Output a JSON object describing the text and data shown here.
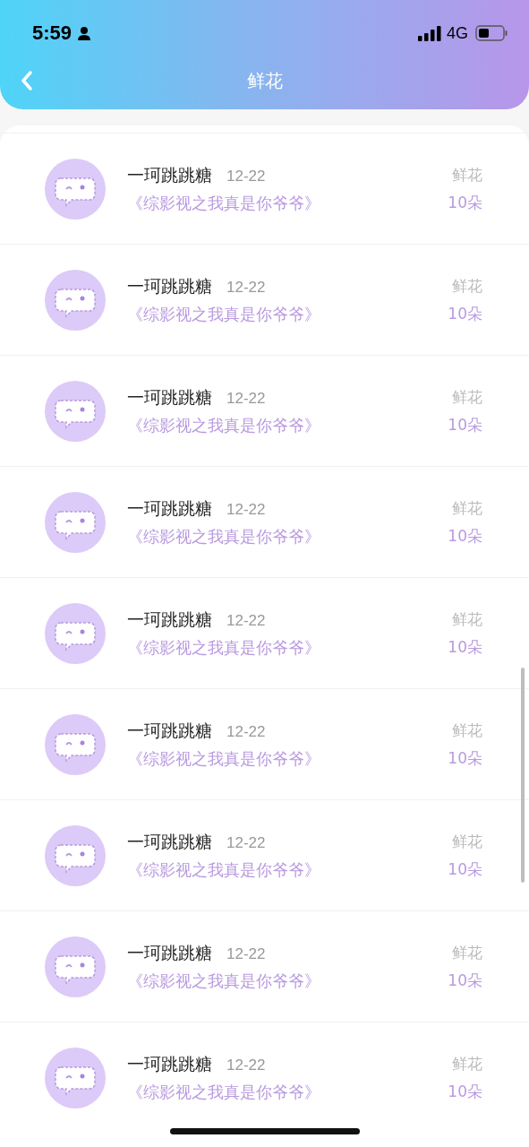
{
  "status_bar": {
    "time": "5:59",
    "network": "4G"
  },
  "header": {
    "title": "鲜花"
  },
  "rows": [
    {
      "name": "一珂跳跳糖",
      "date": "12-22",
      "book": "《综影视之我真是你爷爷》",
      "label": "鲜花",
      "amount": "10朵"
    },
    {
      "name": "一珂跳跳糖",
      "date": "12-22",
      "book": "《综影视之我真是你爷爷》",
      "label": "鲜花",
      "amount": "10朵"
    },
    {
      "name": "一珂跳跳糖",
      "date": "12-22",
      "book": "《综影视之我真是你爷爷》",
      "label": "鲜花",
      "amount": "10朵"
    },
    {
      "name": "一珂跳跳糖",
      "date": "12-22",
      "book": "《综影视之我真是你爷爷》",
      "label": "鲜花",
      "amount": "10朵"
    },
    {
      "name": "一珂跳跳糖",
      "date": "12-22",
      "book": "《综影视之我真是你爷爷》",
      "label": "鲜花",
      "amount": "10朵"
    },
    {
      "name": "一珂跳跳糖",
      "date": "12-22",
      "book": "《综影视之我真是你爷爷》",
      "label": "鲜花",
      "amount": "10朵"
    },
    {
      "name": "一珂跳跳糖",
      "date": "12-22",
      "book": "《综影视之我真是你爷爷》",
      "label": "鲜花",
      "amount": "10朵"
    },
    {
      "name": "一珂跳跳糖",
      "date": "12-22",
      "book": "《综影视之我真是你爷爷》",
      "label": "鲜花",
      "amount": "10朵"
    },
    {
      "name": "一珂跳跳糖",
      "date": "12-22",
      "book": "《综影视之我真是你爷爷》",
      "label": "鲜花",
      "amount": "10朵"
    }
  ]
}
